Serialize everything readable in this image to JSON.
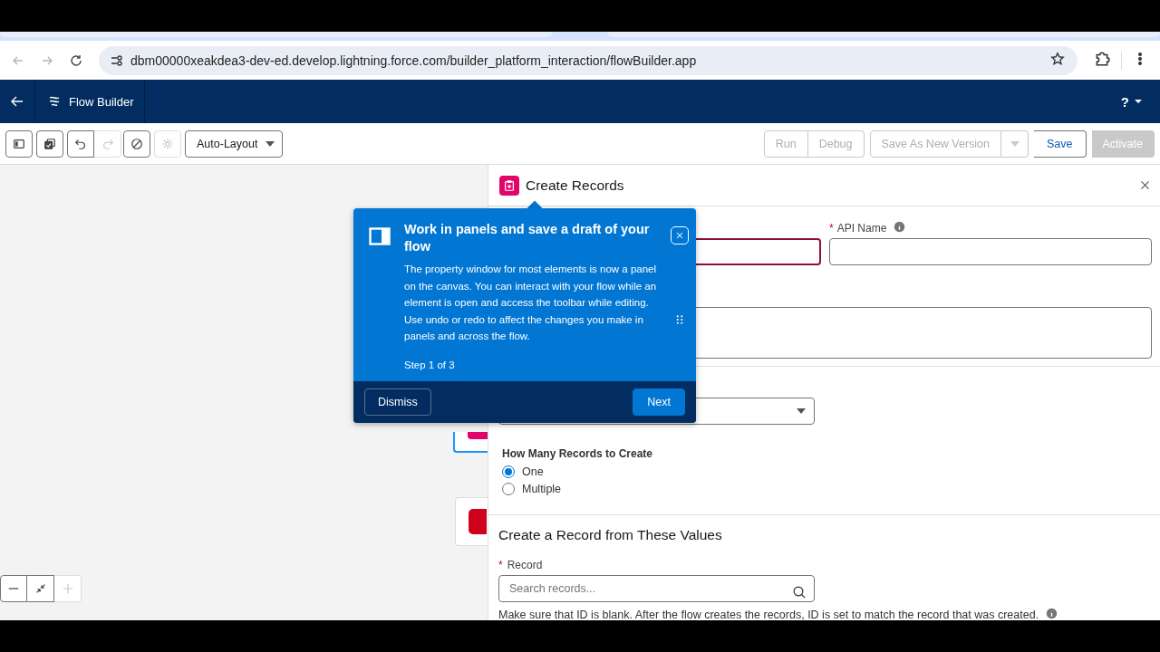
{
  "browser": {
    "url": "dbm00000xeakdea3-dev-ed.develop.lightning.force.com/builder_platform_interaction/flowBuilder.app"
  },
  "app_header": {
    "title": "Flow Builder",
    "help_label": "?"
  },
  "toolbar": {
    "tools": [
      {
        "disabled": false
      },
      {
        "disabled": false
      },
      {
        "disabled": false
      },
      {
        "disabled": true
      },
      {
        "disabled": false
      },
      {
        "disabled": true
      }
    ],
    "layout_menu": {
      "value": "Auto-Layout"
    },
    "action_groups": [
      [
        {
          "label": "Run",
          "kind": "neutral",
          "disabled": true
        },
        {
          "label": "Debug",
          "kind": "neutral",
          "disabled": true
        }
      ],
      [
        {
          "label": "Save As New Version",
          "kind": "split",
          "disabled": true
        }
      ],
      [
        {
          "label": "Save",
          "kind": "neutral",
          "disabled": false
        }
      ],
      [
        {
          "label": "Activate",
          "kind": "brand",
          "disabled": true
        }
      ]
    ]
  },
  "canvas": {
    "zoom_controls": [
      {
        "disabled": false
      },
      {
        "disabled": false
      },
      {
        "disabled": true
      }
    ],
    "nodes": [
      {
        "selected": true,
        "color": "#e3066a"
      },
      {
        "selected": false,
        "color": "#d0021b"
      }
    ]
  },
  "panel": {
    "title": "Create Records",
    "label_field": {
      "invalid": true
    },
    "api_name_field": {
      "label": "API Name",
      "required_mark": "*"
    },
    "record_count": {
      "label": "How Many Records to Create",
      "options": [
        {
          "label": "One",
          "selected": true
        },
        {
          "label": "Multiple",
          "selected": false
        }
      ]
    },
    "values_section": {
      "title": "Create a Record from These Values",
      "record": {
        "label": "Record",
        "required_mark": "*",
        "placeholder": "Search records..."
      },
      "help": "Make sure that ID is blank. After the flow creates the records, ID is set to match the record that was created."
    }
  },
  "popover": {
    "title": "Work in panels and save a draft of your flow",
    "body": "The property window for most elements is now a panel on the canvas. You can interact with your flow while an element is open and access the toolbar while editing. Use undo or redo to affect the changes you make in panels and across the flow.",
    "step": "Step 1 of 3",
    "buttons": [
      {
        "label": "Dismiss",
        "kind": "outline"
      },
      {
        "label": "Next",
        "kind": "brand"
      }
    ]
  }
}
